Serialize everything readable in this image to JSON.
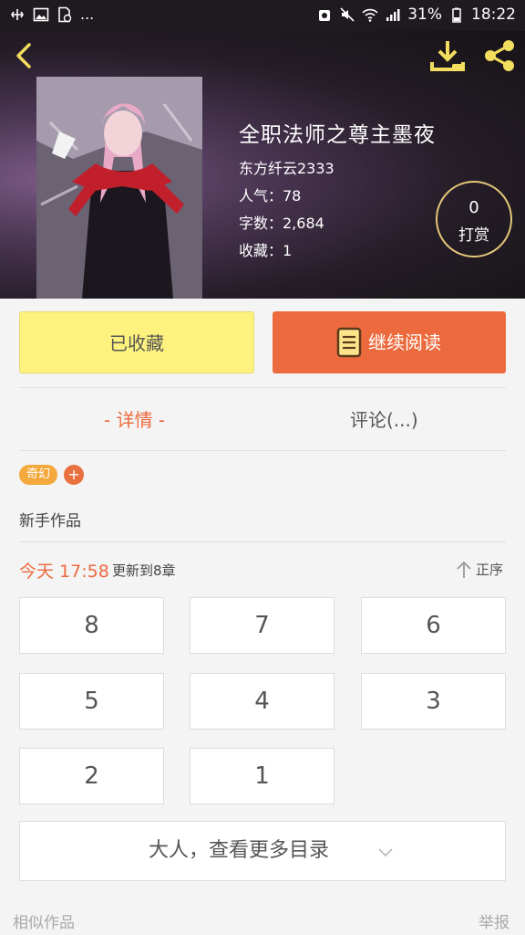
{
  "status_bar": {
    "dots": "...",
    "battery_percent": "31%",
    "time": "18:22"
  },
  "book": {
    "title": "全职法师之尊主墨夜",
    "author": "东方纤云2333",
    "popularity": "人气：78",
    "word_count": "字数：2,684",
    "favorites": "收藏：1"
  },
  "reward": {
    "count": "0",
    "label": "打赏"
  },
  "actions": {
    "favorited_label": "已收藏",
    "continue_label": "继续阅读"
  },
  "tabs": {
    "detail": "- 详情 -",
    "comments": "评论(...)"
  },
  "tags": {
    "genre": "奇幻",
    "add": "+"
  },
  "work_type": "新手作品",
  "update": {
    "time": "今天 17:58",
    "text": "更新到8章",
    "sort_label": "正序"
  },
  "chapters": [
    "8",
    "7",
    "6",
    "5",
    "4",
    "3",
    "2",
    "1"
  ],
  "more_catalog": "大人，查看更多目录",
  "footer": {
    "similar": "相似作品",
    "report": "举报"
  },
  "colors": {
    "accent": "#ec6a3d",
    "favorite_button": "#fdf27d",
    "reward_ring": "#e3c679"
  },
  "icons": [
    "back-arrow-icon",
    "download-icon",
    "share-icon",
    "book-icon",
    "sort-up-arrow-icon",
    "chevron-down-icon"
  ]
}
